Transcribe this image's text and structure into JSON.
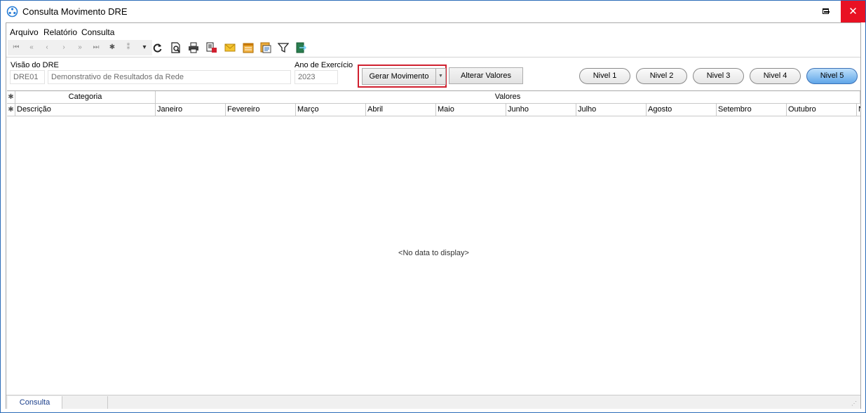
{
  "window": {
    "title": "Consulta Movimento DRE",
    "accent_color": "#2b6cb8",
    "close_color": "#e81123",
    "close_glyph": "✕"
  },
  "menu": [
    "Arquivo",
    "Relatório",
    "Consulta"
  ],
  "toolbar": {
    "nav_icons": [
      "first-icon",
      "prev-page-icon",
      "prev-icon",
      "next-icon",
      "next-page-icon",
      "last-icon",
      "insert-icon",
      "append-icon",
      "filter-small-icon"
    ],
    "nav_glyphs": [
      "⏮",
      "«",
      "‹",
      "›",
      "»",
      "⏭",
      "✱",
      "⁑",
      "▾"
    ],
    "action_icons": [
      "refresh-icon",
      "preview-icon",
      "print-icon",
      "export-icon",
      "email-icon",
      "calendar-icon",
      "report-icon",
      "filter-icon",
      "exit-icon"
    ]
  },
  "form": {
    "visao_label": "Visão do DRE",
    "visao_code": "DRE01",
    "visao_desc": "Demonstrativo de Resultados da Rede",
    "ano_label": "Ano de Exercício",
    "ano_value": "2023",
    "gerar_label": "Gerar Movimento",
    "alterar_label": "Alterar Valores",
    "highlight_color": "#d0202f"
  },
  "levels": {
    "items": [
      "Nivel 1",
      "Nivel 2",
      "Nivel 3",
      "Nivel 4",
      "Nivel 5"
    ],
    "active": "Nivel 5"
  },
  "grid": {
    "band_categoria": "Categoria",
    "band_valores": "Valores",
    "indicator": "✱",
    "columns": [
      "Descrição",
      "Janeiro",
      "Fevereiro",
      "Março",
      "Abril",
      "Maio",
      "Junho",
      "Julho",
      "Agosto",
      "Setembro",
      "Outubro",
      "N"
    ],
    "empty_text": "<No data to display>"
  },
  "status": {
    "tab": "Consulta"
  }
}
